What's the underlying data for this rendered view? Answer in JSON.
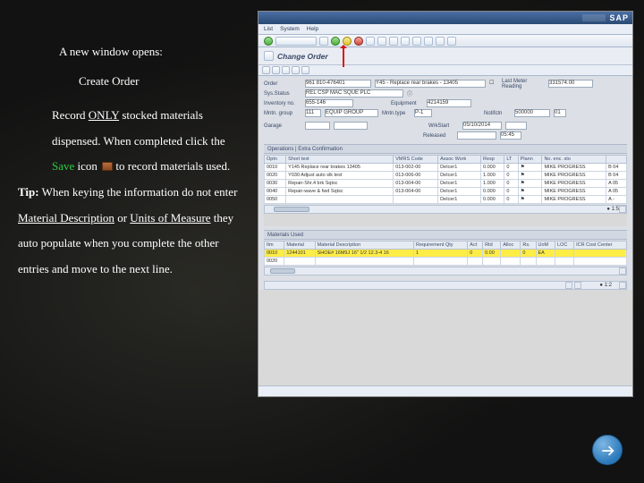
{
  "left": {
    "intro": "A new window opens:",
    "title": "Create Order",
    "para1_a": "Record ",
    "para1_only": "ONLY",
    "para1_b": " stocked materials dispensed.    When completed click the ",
    "save_word": "Save",
    "para1_c": " icon ",
    "para1_d": " to record materials used.",
    "tip_label": "Tip:",
    "tip_a": "  When keying the information do not enter ",
    "tip_mat": "Material Description",
    "tip_b": "  or ",
    "tip_unit": "Units of Measure",
    "tip_c": " they auto populate when you complete the other entries and move to the next line."
  },
  "app": {
    "brand": "SAP",
    "menu": {
      "m1": "List",
      "m2": "System",
      "m3": "Help"
    },
    "screen_title": "Change Order",
    "order_lbl": "Order",
    "order_val": "961  810-476401",
    "order_desc": "Y45 - Replace rear brakes - 13405",
    "sysstat_lbl": "Sys.Status",
    "sysstat_val": "REL  CSP  MAC  SQUE  PLC",
    "mrcol_lbl": "Last Meter Reading",
    "mrcol_val": "331574.00",
    "inv_lbl": "Inventory no.",
    "inv_val": "655-146",
    "equip_lbl": "Equipment",
    "equip_val": "4214159",
    "mngrp_lbl": "Mntn. group",
    "mngrp_val": "111  EQUIP GROUP",
    "mntype_lbl": "Mntn.type",
    "mntype_val": "P-1",
    "notif_lbl": "Notifctn",
    "notif_val": "500000  01",
    "garage_lbl": "Garage",
    "garage_val": "",
    "wrk_lbl": "WrkStart",
    "wrk_date": "05/10/2014",
    "released_lbl": "Released",
    "released_val": "05:45",
    "ops_header": "Operations | Extra Confirmation",
    "ops_cols": {
      "c1": "Optn",
      "c2": "Short text",
      "c3": "VMRS Code",
      "c4": "Assoc Work",
      "c5": "Resp",
      "c6": "LT",
      "c7": "Plann",
      "c8": "No. enc. sto",
      "c9": ""
    },
    "ops_rows": [
      {
        "c1": "0010",
        "c2": "Y145  Replace rear brakes  13405",
        "c3": "013-002-00",
        "c4": "DeIcer1",
        "c5": "0.000",
        "c6": "0",
        "c7": "⚑",
        "c8": "MIKE PROGRESS",
        "c9": "B 04"
      },
      {
        "c1": "0020",
        "c2": "Y030  Adjust auto slk test",
        "c3": "013-006-00",
        "c4": "DeIcer1",
        "c5": "1.000",
        "c6": "0",
        "c7": "⚑",
        "c8": "MIKE PROGRESS",
        "c9": "B 04"
      },
      {
        "c1": "0030",
        "c2": "Repair-Shr.4 brk Sqtsc",
        "c3": "013-004-00",
        "c4": "DeIcer1",
        "c5": "1.000",
        "c6": "0",
        "c7": "⚑",
        "c8": "MIKE PROGRESS",
        "c9": "A 05"
      },
      {
        "c1": "0040",
        "c2": "Repair-wave & fwd Sqtsc",
        "c3": "013-004-00",
        "c4": "DeIcer1",
        "c5": "0.000",
        "c6": "0",
        "c7": "⚑",
        "c8": "MIKE PROGRESS",
        "c9": "A 05"
      },
      {
        "c1": "0050",
        "c2": "",
        "c3": "",
        "c4": "DeIcer1",
        "c5": "0.000",
        "c6": "0",
        "c7": "⚑",
        "c8": "MIKE PROGRESS",
        "c9": "A -"
      }
    ],
    "mat_header": "Materials Used",
    "mat_cols": {
      "c1": "Itm",
      "c2": "Material",
      "c3": "Material Description",
      "c4": "Requirement Qty",
      "c5": "Act",
      "c6": "Rtd",
      "c7": "Alloc",
      "c8": "Rs.",
      "c9": "UoM",
      "c10": "LOC",
      "c11": "ICR Cost Center"
    },
    "mat_rows": [
      {
        "c1": "0010",
        "c2": "1244101",
        "c3": "SHOE# 16M9J 16\" 1/2 12.3-4 16",
        "c4": "1",
        "c5": "0",
        "c6": "0.00",
        "c7": "",
        "c8": "0",
        "c9": "EA",
        "c10": "",
        "c11": ""
      },
      {
        "c1": "0020",
        "c2": "",
        "c3": "",
        "c4": "",
        "c5": "",
        "c6": "",
        "c7": "",
        "c8": "",
        "c9": "",
        "c10": "",
        "c11": ""
      }
    ],
    "status_text": ""
  },
  "nav": {
    "next": "Next"
  }
}
